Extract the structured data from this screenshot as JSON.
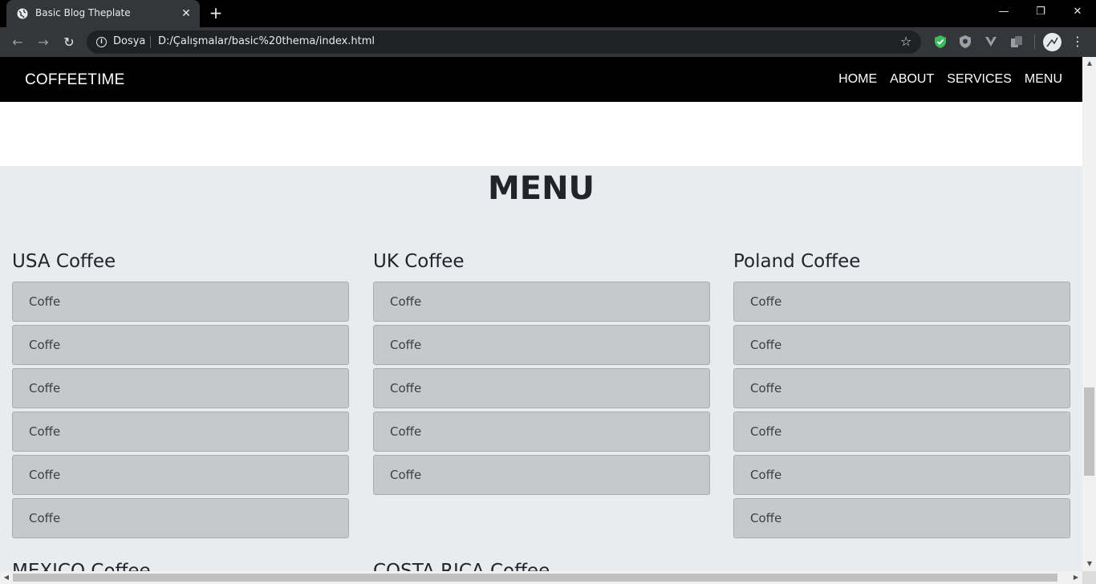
{
  "browser": {
    "tab_title": "Basic Blog Theplate",
    "tab_close": "✕",
    "new_tab": "+",
    "site_label": "Dosya",
    "url": "D:/Çalışmalar/basic%20thema/index.html",
    "win_minimize": "—",
    "win_restore": "❐",
    "win_close": "✕"
  },
  "site": {
    "brand": "COFFEETIME",
    "nav": [
      "HOME",
      "ABOUT",
      "SERVICES",
      "MENU"
    ],
    "section_title": "MENU",
    "columns": [
      {
        "title": "USA Coffee",
        "items": [
          "Coffe",
          "Coffe",
          "Coffe",
          "Coffe",
          "Coffe",
          "Coffe"
        ]
      },
      {
        "title": "UK Coffee",
        "items": [
          "Coffe",
          "Coffe",
          "Coffe",
          "Coffe",
          "Coffe"
        ]
      },
      {
        "title": "Poland Coffee",
        "items": [
          "Coffe",
          "Coffe",
          "Coffe",
          "Coffe",
          "Coffe",
          "Coffe"
        ]
      }
    ],
    "next_row_titles": [
      "MEXICO Coffee",
      "COSTA RICA Coffee"
    ]
  },
  "icons": {
    "favicon": "globe-icon",
    "back": "arrow-left-icon",
    "forward": "arrow-right-icon",
    "reload": "reload-icon",
    "info": "info-icon",
    "bookmark": "star-icon",
    "extensions": [
      "shield-check-icon",
      "shield-icon",
      "vivaldi-v-icon",
      "copy-icon"
    ],
    "profile": "avatar-icon",
    "menu": "kebab-menu-icon"
  },
  "colors": {
    "nav_bg": "#000000",
    "page_bg": "#e9ecef",
    "item_bg": "#c6c8ca",
    "text": "#212529"
  }
}
